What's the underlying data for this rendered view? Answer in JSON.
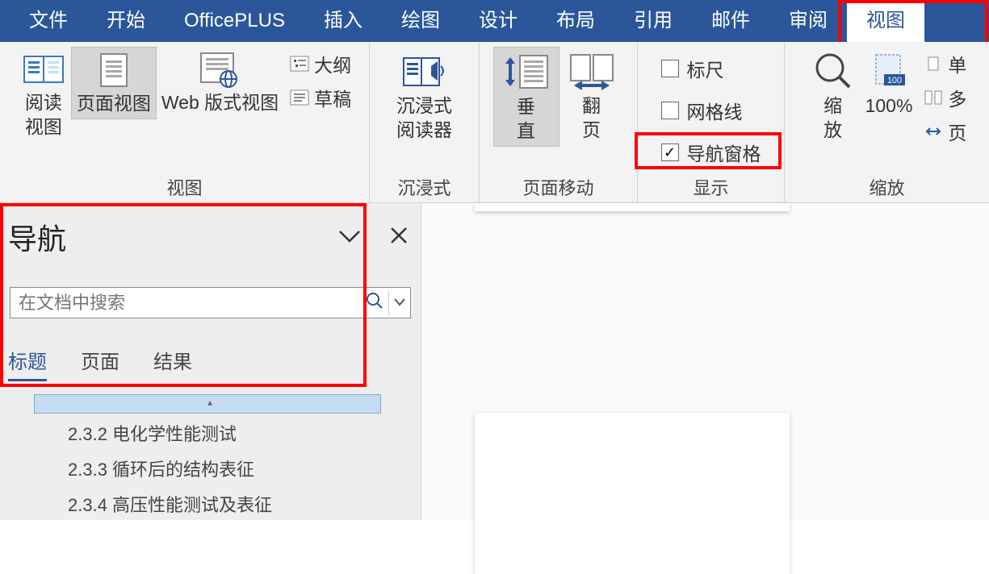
{
  "tabs": {
    "file": "文件",
    "home": "开始",
    "officeplus": "OfficePLUS",
    "insert": "插入",
    "draw": "绘图",
    "design": "设计",
    "layout": "布局",
    "references": "引用",
    "mailings": "邮件",
    "review": "审阅",
    "view": "视图"
  },
  "ribbon": {
    "views_group": "视图",
    "read_mode": "阅读\n视图",
    "print_layout": "页面视图",
    "web_layout": "Web 版式视图",
    "outline": "大纲",
    "draft": "草稿",
    "immersive_group": "沉浸式",
    "immersive_reader": "沉浸式\n阅读器",
    "page_movement_group": "页面移动",
    "vertical": "垂\n直",
    "side_to_side": "翻\n页",
    "show_group": "显示",
    "ruler": "标尺",
    "gridlines": "网格线",
    "nav_pane": "导航窗格",
    "zoom_group": "缩放",
    "zoom": "缩\n放",
    "hundred": "100%",
    "one_page": "单",
    "multi_page": "多",
    "page_width": "页"
  },
  "nav": {
    "title": "导航",
    "placeholder": "在文档中搜索",
    "tab_headings": "标题",
    "tab_pages": "页面",
    "tab_results": "结果",
    "headings": [
      "2.3.2 电化学性能测试",
      "2.3.3 循环后的结构表征",
      "2.3.4 高压性能测试及表征"
    ]
  }
}
